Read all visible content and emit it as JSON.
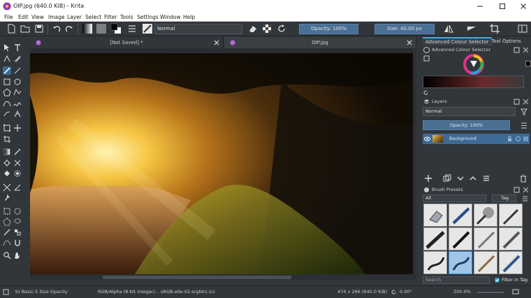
{
  "window": {
    "title": "OIP.jpg (640.0 KiB) - Krita"
  },
  "menu": [
    "File",
    "Edit",
    "View",
    "Image",
    "Layer",
    "Select",
    "Filter",
    "Tools",
    "Settings",
    "Window",
    "Help"
  ],
  "toolbar": {
    "blend_mode": "Normal",
    "opacity": "Opacity: 100%",
    "size": "Size: 40.00 px"
  },
  "tabs": [
    {
      "label": "[Not Saved] *"
    },
    {
      "label": "OIP.jpg"
    }
  ],
  "dock": {
    "tabs": [
      "Advanced Colour Selector",
      "Tool Options"
    ],
    "color_selector_title": "Advanced Colour Selector",
    "layers_title": "Layers",
    "layer_blend": "Normal",
    "layer_opacity": "Opacity:  100%",
    "layer_name": "Background",
    "presets_title": "Brush Presets",
    "preset_filter": "All",
    "tag_label": "Tag",
    "search_placeholder": "Search",
    "filter_in_tag": "Filter in Tag"
  },
  "status": {
    "brush": "b) Basic-5 Size Opacity",
    "color_profile": "RGB/Alpha (8-bit integer/... sRGB-elle-V2-srgbtrc.icc",
    "image_size": "474 x 266 (640.0 KiB)",
    "rotation": "0.00°",
    "zoom": "200.0%"
  },
  "colors": {
    "accent": "#3daee9",
    "selection": "#4a6f94",
    "panel": "#31363b"
  }
}
